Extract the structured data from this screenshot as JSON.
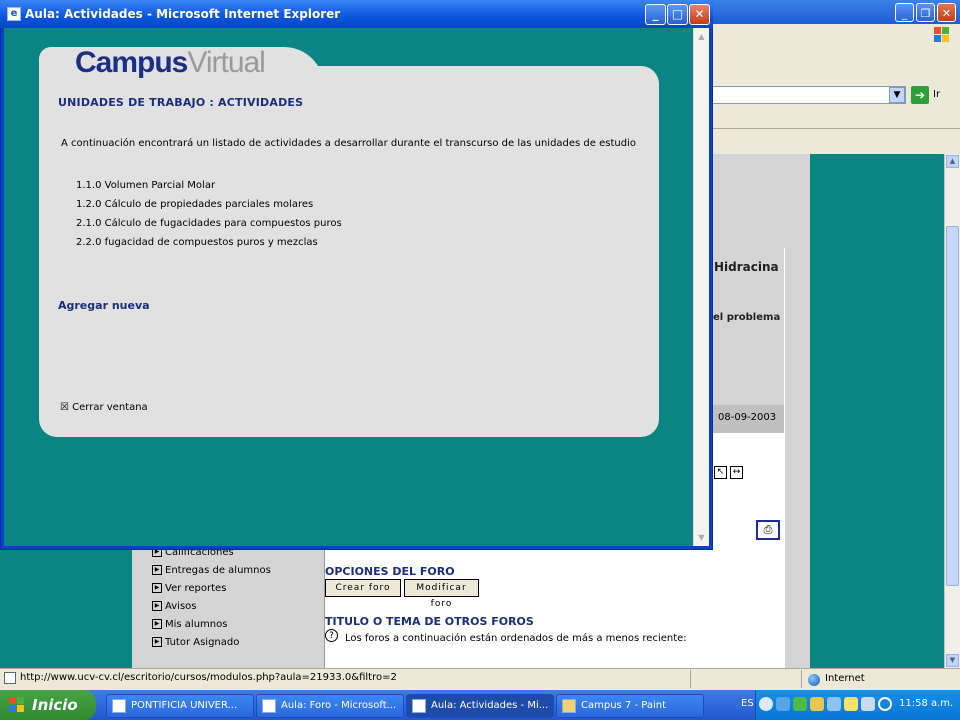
{
  "window": {
    "title": "Aula: Actividades - Microsoft Internet Explorer",
    "icon": "ie-icon",
    "min": "_",
    "max": "□",
    "close": "✕"
  },
  "panel": {
    "logo_part1": "Campus",
    "logo_part2": "Virtual",
    "heading": "UNIDADES DE TRABAJO : ACTIVIDADES",
    "intro": "A continuación encontrará un listado de actividades a desarrollar durante el transcurso de las unidades de estudio",
    "activities": [
      "1.1.0 Volumen Parcial Molar",
      "1.2.0 Cálculo de propiedades parciales molares",
      "2.1.0 Cálculo de fugacidades para compuestos puros",
      "2.2.0 fugacidad de compuestos puros y mezclas"
    ],
    "add_link": "Agregar nueva",
    "close_link": "Cerrar ventana",
    "close_icon": "☒"
  },
  "background": {
    "go_label": "Ir",
    "go_icon": "➔",
    "forum_title": "Hidracina",
    "forum_text": "el problema",
    "forum_date": "08-09-2003",
    "left_menu": [
      "Calificaciones",
      "Entregas de alumnos",
      "Ver reportes",
      "Avisos",
      "Mis alumnos",
      "Tutor Asignado"
    ],
    "forum_options_title": "OPCIONES DEL FORO",
    "create_forum": "Crear foro",
    "modify_forum": "Modificar foro",
    "other_forums_title": "TITULO O TEMA DE OTROS FOROS",
    "forums_info": "Los foros a continuación están ordenados de más a menos reciente:",
    "help_icon": "?"
  },
  "statusbar": {
    "url": "http://www.ucv-cv.cl/escritorio/cursos/modulos.php?aula=21933.0&filtro=2",
    "zone": "Internet"
  },
  "taskbar": {
    "start": "Inicio",
    "items": [
      "PONTIFICIA UNIVER...",
      "Aula: Foro - Microsoft...",
      "Aula: Actividades - Mi...",
      "Campus 7 - Paint"
    ],
    "lang": "ES",
    "clock": "11:58 a.m."
  },
  "colors": {
    "teal": "#0b8584",
    "panel": "#e1e1e1",
    "heading": "#1b2d7e",
    "xp_blue": "#0a55dc"
  }
}
